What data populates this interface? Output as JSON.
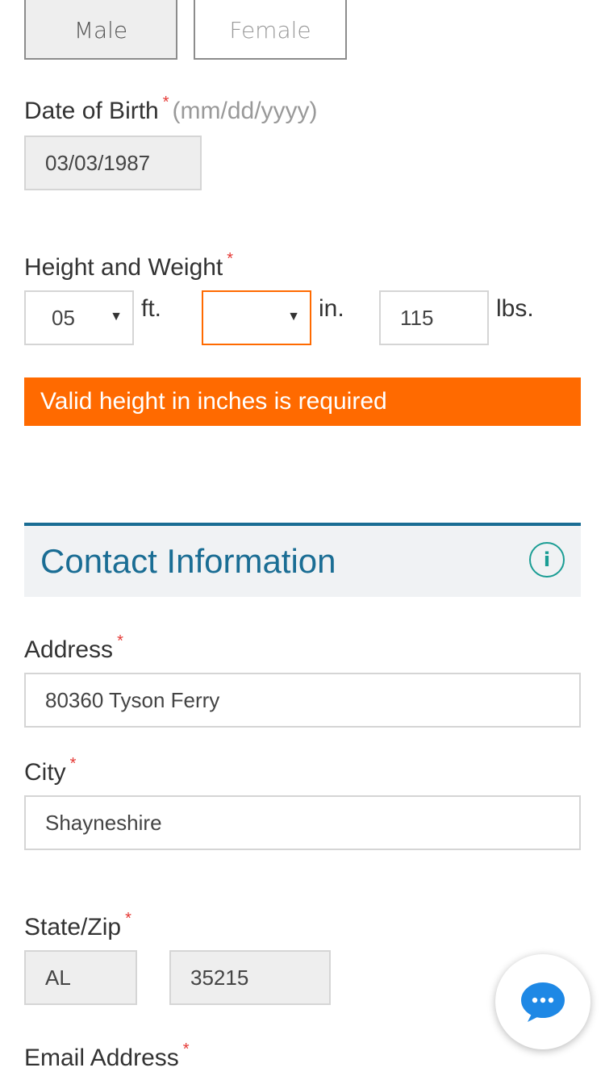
{
  "gender": {
    "male": "Male",
    "female": "Female"
  },
  "dob": {
    "label": "Date of Birth",
    "hint": "(mm/dd/yyyy)",
    "value": "03/03/1987"
  },
  "height_weight": {
    "label": "Height and Weight",
    "feet_value": "05",
    "feet_unit": "ft.",
    "inches_value": "",
    "inches_unit": "in.",
    "weight_value": "115",
    "weight_unit": "lbs."
  },
  "error": {
    "message": "Valid height in inches is required"
  },
  "contact": {
    "title": "Contact Information",
    "info_glyph": "i"
  },
  "address": {
    "label": "Address",
    "value": "80360 Tyson Ferry"
  },
  "city": {
    "label": "City",
    "value": "Shayneshire"
  },
  "state_zip": {
    "label": "State/Zip",
    "state": "AL",
    "zip": "35215"
  },
  "email": {
    "label": "Email Address"
  },
  "required_marker": "*",
  "colors": {
    "accent": "#1a6d94",
    "error": "#ff6a00",
    "required": "#e53935",
    "chat": "#1e88e5"
  },
  "icons": {
    "info": "info-icon",
    "chat": "chat-bubble-icon",
    "dropdown": "caret-down-icon"
  }
}
